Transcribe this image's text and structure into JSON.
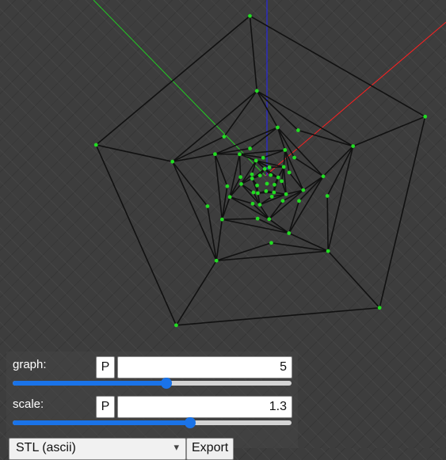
{
  "viewport": {
    "axes": {
      "x_color": "#ff2020",
      "y_color": "#22cc22",
      "z_color": "#2222ff"
    },
    "edge_color": "#111111",
    "vertex_color": "#22dd22",
    "outer_ring_vertices": 5
  },
  "controls": {
    "graph": {
      "label": "graph:",
      "p_label": "P",
      "value": "5",
      "slider_fraction": 0.55
    },
    "scale": {
      "label": "scale:",
      "p_label": "P",
      "value": "1.3",
      "slider_fraction": 0.635
    },
    "export": {
      "format": "STL (ascii)",
      "button_label": "Export"
    }
  }
}
